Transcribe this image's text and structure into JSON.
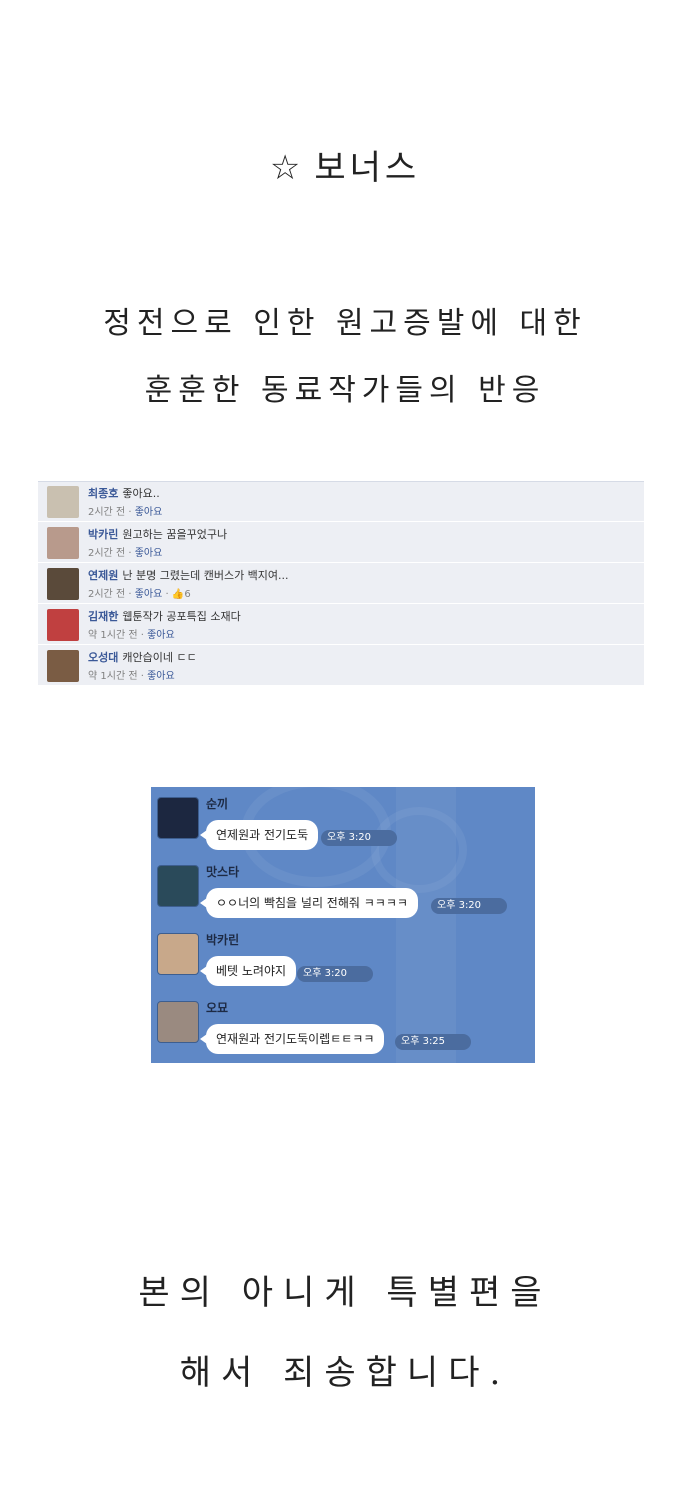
{
  "title": "보너스",
  "title_icon": "star-icon",
  "intro_lines": [
    "정전으로 인한 원고증발에 대한",
    "훈훈한 동료작가들의 반응"
  ],
  "facebook_comments": [
    {
      "name": "최종호",
      "text": "좋아요..",
      "time": "2시간 전",
      "like": "좋아요",
      "likes": "",
      "avatar_color": "#c9c0b0"
    },
    {
      "name": "박카린",
      "text": "원고하는 꿈을꾸었구나",
      "time": "2시간 전",
      "like": "좋아요",
      "likes": "",
      "avatar_color": "#b89a8c"
    },
    {
      "name": "연제원",
      "text": "난 분명 그렸는데 캔버스가 백지여...",
      "time": "2시간 전",
      "like": "좋아요",
      "likes": "6",
      "avatar_color": "#5a4a3a"
    },
    {
      "name": "김재한",
      "text": "웹툰작가 공포특집 소재다",
      "time": "약 1시간 전",
      "like": "좋아요",
      "likes": "",
      "avatar_color": "#c04040"
    },
    {
      "name": "오성대",
      "text": "캐안습이네 ㄷㄷ",
      "time": "약 1시간 전",
      "like": "좋아요",
      "likes": "",
      "avatar_color": "#7a5c44"
    }
  ],
  "chat_messages": [
    {
      "name": "순끼",
      "text": "연제원과 전기도둑",
      "time": "오후 3:20",
      "avatar_color": "#1c2740"
    },
    {
      "name": "맛스타",
      "text": "ㅇㅇ너의 빡침을 널리 전해줘 ㅋㅋㅋㅋ",
      "time": "오후 3:20",
      "avatar_color": "#2a4a5a"
    },
    {
      "name": "박카린",
      "text": "베텟 노려야지",
      "time": "오후 3:20",
      "avatar_color": "#c8a88a"
    },
    {
      "name": "오묘",
      "text": "연재원과 전기도둑이렙ㅌㅌㅋㅋ",
      "time": "오후 3:25",
      "avatar_color": "#9a8a80"
    }
  ],
  "closing_lines": [
    "본의 아니게 특별편을",
    "해서 죄송합니다."
  ]
}
